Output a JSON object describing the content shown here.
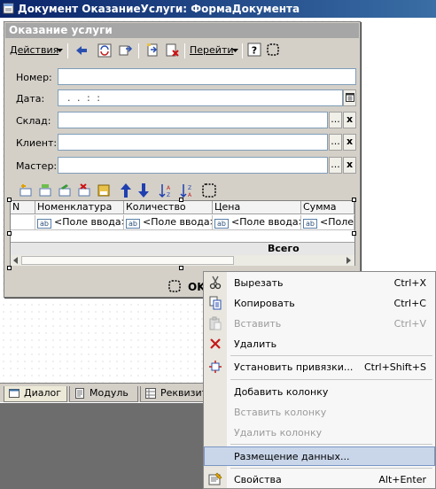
{
  "window": {
    "title": "Документ ОказаниеУслуги: ФормаДокумента"
  },
  "form": {
    "title": "Оказание услуги",
    "toolbar": {
      "actions_label": "Действия",
      "goto_label": "Перейти"
    },
    "fields": {
      "number_label": "Номер:",
      "date_label": "Дата:",
      "date_mask": ". .  : :",
      "warehouse_label": "Склад:",
      "client_label": "Клиент:",
      "master_label": "Мастер:",
      "select_button": "...",
      "clear_button": "x"
    },
    "table": {
      "columns": [
        "N",
        "Номенклатура",
        "Количество",
        "Цена",
        "Сумма"
      ],
      "input_icon_text": "ab",
      "cell_placeholder": "<Поле ввода>",
      "total_label": "Всего"
    },
    "ok_button": "OK"
  },
  "tabs": [
    {
      "label": "Диалог"
    },
    {
      "label": "Модуль"
    },
    {
      "label": "Реквизиты"
    }
  ],
  "context_menu": {
    "items": [
      {
        "label": "Вырезать",
        "shortcut": "Ctrl+X",
        "enabled": true
      },
      {
        "label": "Копировать",
        "shortcut": "Ctrl+C",
        "enabled": true
      },
      {
        "label": "Вставить",
        "shortcut": "Ctrl+V",
        "enabled": false
      },
      {
        "label": "Удалить",
        "shortcut": "",
        "enabled": true
      },
      {
        "label": "Установить привязки...",
        "shortcut": "Ctrl+Shift+S",
        "enabled": true
      },
      {
        "label": "Добавить колонку",
        "shortcut": "",
        "enabled": true
      },
      {
        "label": "Вставить колонку",
        "shortcut": "",
        "enabled": false
      },
      {
        "label": "Удалить колонку",
        "shortcut": "",
        "enabled": false
      },
      {
        "label": "Размещение данных...",
        "shortcut": "",
        "enabled": true,
        "highlighted": true
      },
      {
        "label": "Свойства",
        "shortcut": "Alt+Enter",
        "enabled": true
      }
    ]
  }
}
